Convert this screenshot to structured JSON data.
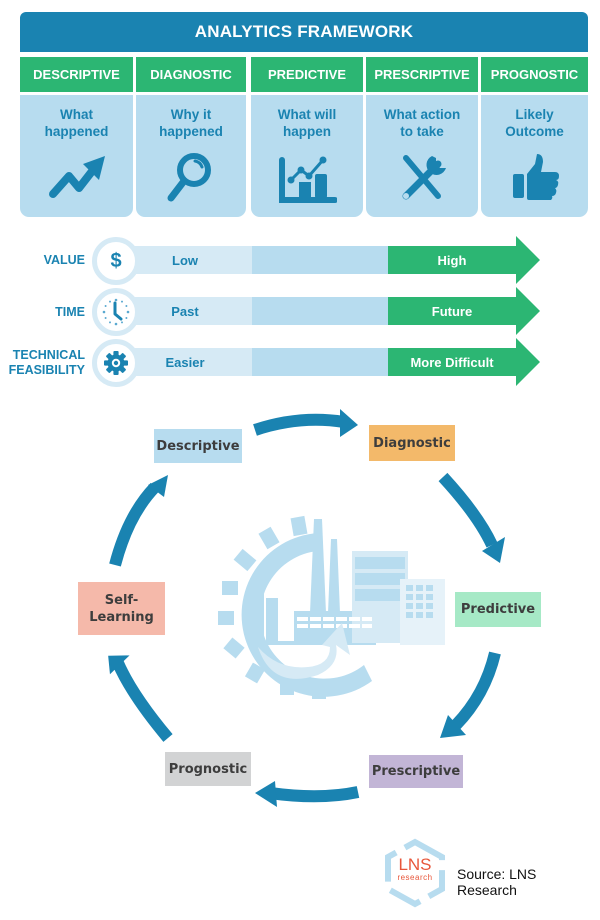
{
  "header": {
    "title": "ANALYTICS FRAMEWORK"
  },
  "colors": {
    "header_blue": "#1a83b1",
    "green": "#2cb673",
    "light_blue": "#b7dcef",
    "lighter_blue": "#d6eaf5"
  },
  "framework": {
    "columns": [
      {
        "title": "DESCRIPTIVE",
        "line1": "What",
        "line2": "happened",
        "icon": "trend-up-arrow-icon"
      },
      {
        "title": "DIAGNOSTIC",
        "line1": "Why it",
        "line2": "happened",
        "icon": "magnifier-icon"
      },
      {
        "title": "PREDICTIVE",
        "line1": "What will",
        "line2": "happen",
        "icon": "chart-icon"
      },
      {
        "title": "PRESCRIPTIVE",
        "line1": "What action",
        "line2": "to take",
        "icon": "tools-icon"
      },
      {
        "title": "PROGNOSTIC",
        "line1": "Likely",
        "line2": "Outcome",
        "icon": "thumbs-up-icon"
      }
    ]
  },
  "scales": [
    {
      "label_line1": "VALUE",
      "label_line2": "",
      "icon": "dollar-icon",
      "icon_glyph": "$",
      "low": "Low",
      "high": "High"
    },
    {
      "label_line1": "TIME",
      "label_line2": "",
      "icon": "clock-icon",
      "low": "Past",
      "high": "Future"
    },
    {
      "label_line1": "TECHNICAL",
      "label_line2": "FEASIBILITY",
      "icon": "gear-icon",
      "low": "Easier",
      "high": "More Difficult"
    }
  ],
  "cycle": {
    "steps": [
      {
        "line1": "Descriptive",
        "line2": "",
        "color": "#b7dcef"
      },
      {
        "line1": "Diagnostic",
        "line2": "",
        "color": "#f3b96a"
      },
      {
        "line1": "Predictive",
        "line2": "",
        "color": "#a6e9c6"
      },
      {
        "line1": "Prescriptive",
        "line2": "",
        "color": "#c2b5d6"
      },
      {
        "line1": "Prognostic",
        "line2": "",
        "color": "#d2d3d4"
      },
      {
        "line1": "Self-",
        "line2": "Learning",
        "color": "#f5b9aa"
      }
    ],
    "center_image": "factory-gear-illustration"
  },
  "footer": {
    "logo_main": "LNS",
    "logo_sub": "research",
    "source": "Source: LNS Research"
  }
}
